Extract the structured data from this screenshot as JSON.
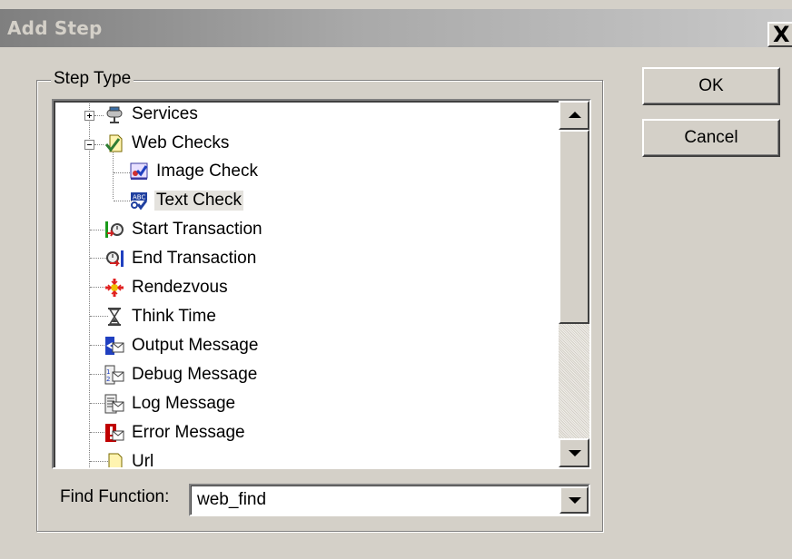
{
  "window": {
    "title": "Add Step",
    "close_glyph": "X"
  },
  "group": {
    "legend": "Step Type"
  },
  "tree": {
    "items": [
      {
        "label": "Services",
        "icon": "services-icon",
        "expander": "plus"
      },
      {
        "label": "Web Checks",
        "icon": "web-checks-folder-icon",
        "expander": "minus"
      },
      {
        "label": "Image Check",
        "icon": "image-check-icon"
      },
      {
        "label": "Text Check",
        "icon": "text-check-icon",
        "selected": true
      },
      {
        "label": "Start Transaction",
        "icon": "start-transaction-icon"
      },
      {
        "label": "End Transaction",
        "icon": "end-transaction-icon"
      },
      {
        "label": "Rendezvous",
        "icon": "rendezvous-icon"
      },
      {
        "label": "Think Time",
        "icon": "hourglass-icon"
      },
      {
        "label": "Output Message",
        "icon": "output-message-icon"
      },
      {
        "label": "Debug Message",
        "icon": "debug-message-icon"
      },
      {
        "label": "Log Message",
        "icon": "log-message-icon"
      },
      {
        "label": "Error Message",
        "icon": "error-message-icon"
      },
      {
        "label": "Url",
        "icon": "url-icon"
      }
    ]
  },
  "find": {
    "label": "Find Function:",
    "value": "web_find"
  },
  "buttons": {
    "ok": "OK",
    "cancel": "Cancel"
  },
  "colors": {
    "dialog_bg": "#d4d0c8",
    "title_gradient_start": "#7f7f7f",
    "selection_bg": "#e4e2dd"
  }
}
